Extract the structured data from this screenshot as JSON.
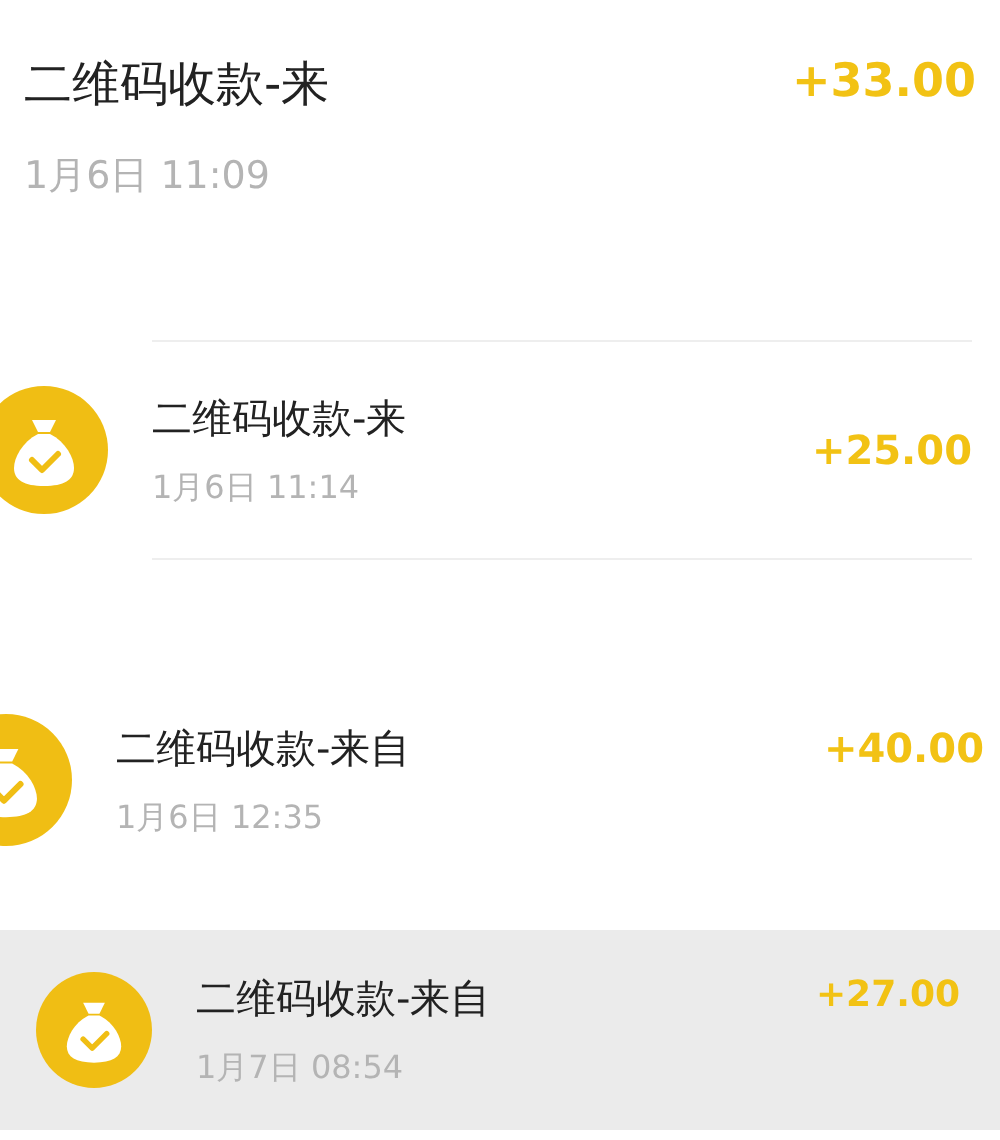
{
  "transactions": [
    {
      "title": "二维码收款-来",
      "time": "1月6日 11:09",
      "amount": "+33.00",
      "icon": false,
      "highlighted": false
    },
    {
      "title": "二维码收款-来",
      "time": "1月6日 11:14",
      "amount": "+25.00",
      "icon": true,
      "highlighted": false
    },
    {
      "title": "二维码收款-来自",
      "time": "1月6日 12:35",
      "amount": "+40.00",
      "icon": true,
      "highlighted": false
    },
    {
      "title": "二维码收款-来自",
      "time": "1月7日 08:54",
      "amount": "+27.00",
      "icon": true,
      "highlighted": true
    }
  ]
}
